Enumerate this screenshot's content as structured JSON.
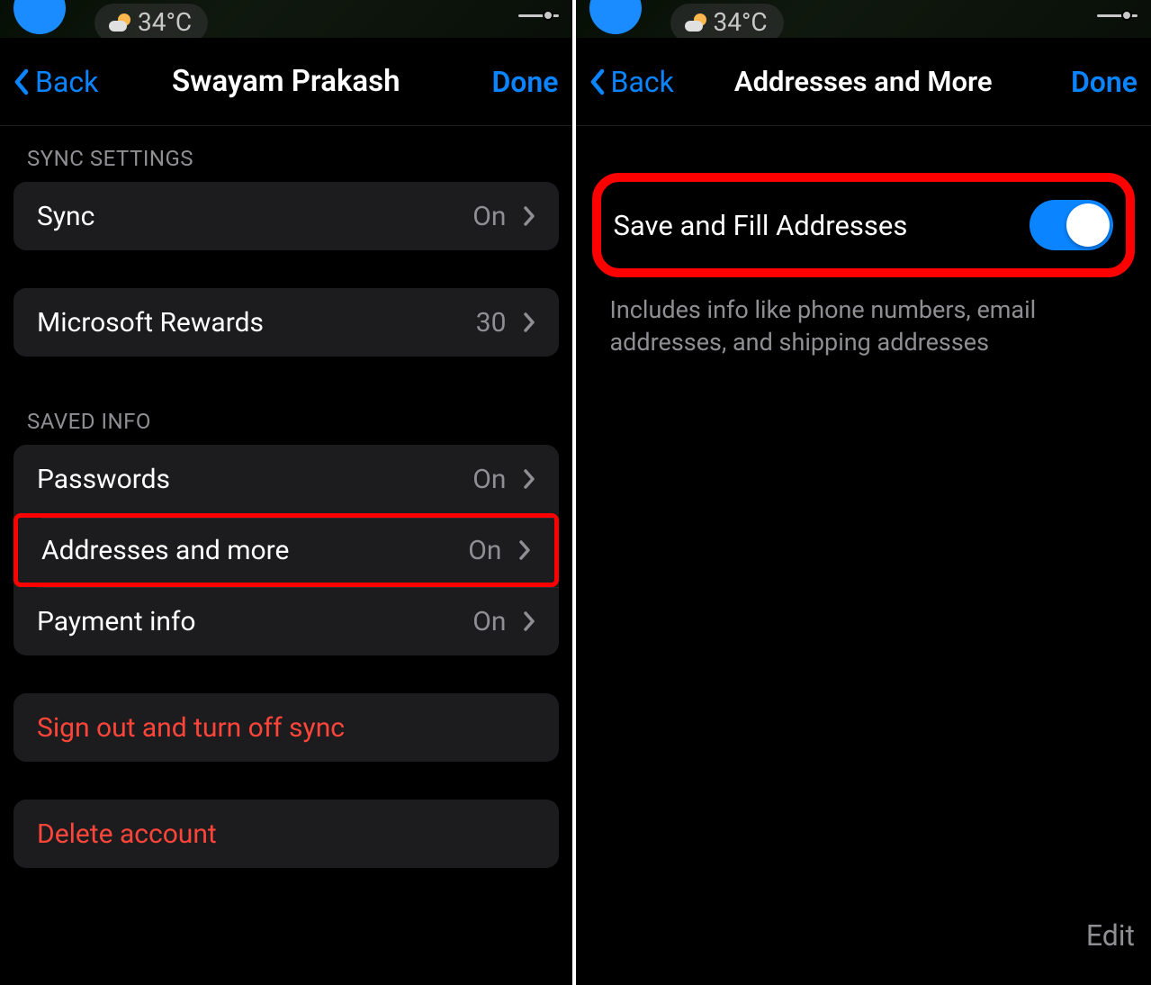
{
  "status": {
    "temperature": "34°C"
  },
  "left": {
    "nav": {
      "back": "Back",
      "title": "Swayam Prakash",
      "done": "Done"
    },
    "sections": {
      "sync_settings": "SYNC SETTINGS",
      "saved_info": "SAVED INFO"
    },
    "rows": {
      "sync": {
        "label": "Sync",
        "value": "On"
      },
      "rewards": {
        "label": "Microsoft Rewards",
        "value": "30"
      },
      "passwords": {
        "label": "Passwords",
        "value": "On"
      },
      "addresses": {
        "label": "Addresses and more",
        "value": "On"
      },
      "payment": {
        "label": "Payment info",
        "value": "On"
      },
      "signout": {
        "label": "Sign out and turn off sync"
      },
      "delete": {
        "label": "Delete account"
      }
    }
  },
  "right": {
    "nav": {
      "back": "Back",
      "title": "Addresses and More",
      "done": "Done"
    },
    "save_fill": {
      "label": "Save and Fill Addresses",
      "description": "Includes info like phone numbers, email addresses, and shipping addresses"
    },
    "edit": "Edit"
  }
}
